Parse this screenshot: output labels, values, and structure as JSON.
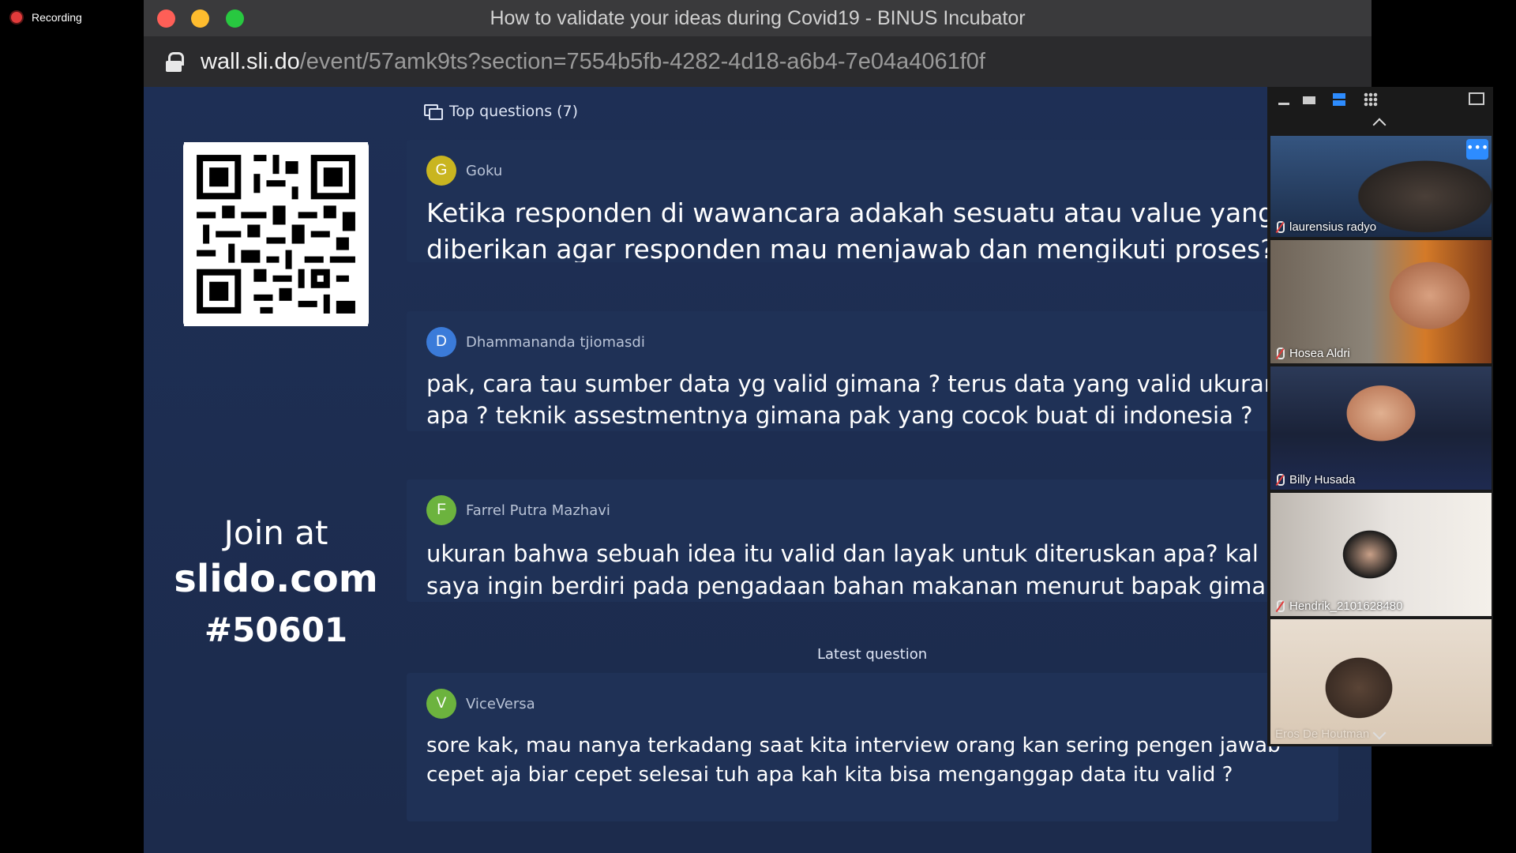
{
  "recording": {
    "label": "Recording"
  },
  "browser": {
    "title": "How to validate your ideas during Covid19 - BINUS Incubator",
    "url_host": "wall.sli.do",
    "url_path": "/event/57amk9ts?section=7554b5fb-4282-4d18-a6b4-7e04a4061f0f"
  },
  "slido": {
    "join_at": "Join at",
    "domain": "slido.com",
    "code": "#50601",
    "top_questions_label": "Top questions (7)",
    "latest_label": "Latest question",
    "questions": [
      {
        "initial": "G",
        "avatar_color": "#c9b520",
        "name": "Goku",
        "line1": "Ketika responden di wawancara adakah sesuatu atau value yang",
        "line2": "diberikan agar responden mau menjawab dan mengikuti proses?"
      },
      {
        "initial": "D",
        "avatar_color": "#3b7bd9",
        "name": "Dhammananda tjiomasdi",
        "line1": "pak, cara tau sumber data yg valid gimana ? terus data yang valid ukuran",
        "line2": "apa ? teknik assestmentnya gimana pak yang cocok buat di indonesia ?"
      },
      {
        "initial": "F",
        "avatar_color": "#6cb33e",
        "name": "Farrel Putra Mazhavi",
        "line1": "ukuran bahwa sebuah idea itu valid dan layak untuk diteruskan apa? kal",
        "line2": "saya ingin berdiri pada pengadaan bahan makanan menurut bapak gima"
      },
      {
        "initial": "V",
        "avatar_color": "#6cb33e",
        "name": "ViceVersa",
        "line1": "sore kak, mau nanya terkadang saat kita interview orang kan sering pengen jawab",
        "line2": "cepet aja biar cepet selesai tuh apa kah kita bisa menganggap data itu valid ?"
      }
    ]
  },
  "gallery": {
    "more_label": "•••",
    "participants": [
      {
        "name": "laurensius radyo",
        "muted": true
      },
      {
        "name": "Hosea Aldri",
        "muted": true
      },
      {
        "name": "Billy Husada",
        "muted": true
      },
      {
        "name": "Hendrik_2101628480",
        "muted": true
      },
      {
        "name": "Eros De Houtman",
        "muted": false
      }
    ]
  }
}
